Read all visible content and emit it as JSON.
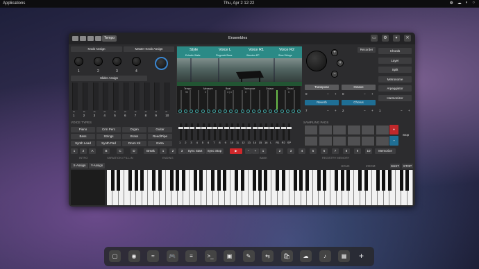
{
  "topbar": {
    "apps": "Applications",
    "clock": "Thu, Apr  2   12:22",
    "tray": [
      "❁",
      "☁",
      "◐",
      "○"
    ]
  },
  "window": {
    "title": "Ensembles",
    "tempo": "Tempo",
    "recorder": "Recorder"
  },
  "left": {
    "knob_assign": "Knob Assign",
    "master_knob_assign": "Master Knob Assign",
    "slider_assign": "Slider Assign",
    "knob_numbers": [
      "1",
      "2",
      "3",
      "4",
      "M"
    ],
    "slider_numbers": [
      "1",
      "2",
      "3",
      "4",
      "5",
      "6",
      "7",
      "8",
      "9",
      "10"
    ]
  },
  "screen": {
    "headers": [
      "Style",
      "Voice L",
      "Voice R1",
      "Voice R2"
    ],
    "subs": [
      "Eclectic Waltz",
      "Fingerstd Bass",
      "Wooden EP",
      "Slow Strings"
    ],
    "params": [
      "Tempo",
      "Measure",
      "Beat",
      "Transpose",
      "Octave",
      "Chord"
    ],
    "values": [
      "90",
      "0",
      "4 | 4",
      "0",
      "0",
      "C"
    ]
  },
  "right": {
    "buttons": [
      "Chords",
      "Layer",
      "Split",
      "Metronome",
      "Arpeggiator",
      "Harmonizer"
    ],
    "fx": [
      "Transpose",
      "Octave",
      "Reverb",
      "Chorus"
    ],
    "fx_vals": [
      "0",
      "0",
      "7",
      "2"
    ],
    "minus": "−",
    "plus": "+",
    "arp_val": "1"
  },
  "voice_types": {
    "title": "VOICE TYPES",
    "items": [
      "Piano",
      "Crm Perc",
      "Organ",
      "Guitar",
      "Bass",
      "Strings",
      "Brass",
      "Reed/Pipe",
      "Synth Lead",
      "Synth Pad",
      "Drum Kit",
      "Extra"
    ]
  },
  "mixer": {
    "labels": [
      "1",
      "2",
      "3",
      "4",
      "5",
      "6",
      "7",
      "8",
      "9",
      "10",
      "11",
      "12",
      "13",
      "14",
      "15",
      "16",
      "L",
      "R1",
      "R2",
      "SP"
    ]
  },
  "sampling": {
    "title": "SAMPLING PADS",
    "stop": "Stop"
  },
  "bottom_row": {
    "items": [
      "1",
      "2",
      "A",
      "B",
      "C",
      "D",
      "Break",
      "1",
      "2",
      "3",
      "Sync Start",
      "Sync Stop",
      "1",
      "−",
      "+",
      "1",
      "2",
      "3",
      "4",
      "5",
      "6",
      "7",
      "8",
      "9",
      "10",
      "Memorize"
    ],
    "section_labels": [
      "INTRO",
      "VARIATION / FILL-IN",
      "ENDING",
      "BANK",
      "REGISTRY MEMORY"
    ]
  },
  "keyboard": {
    "x_assign": "X-Assign",
    "y_assign": "Y-Assign",
    "hold": "HOLD",
    "zoom": "ZOOM",
    "sust": "SUST",
    "stop": "STOP"
  },
  "dock": {
    "icons": [
      "files",
      "chrome",
      "wave",
      "gamepad",
      "stack",
      "terminal",
      "case",
      "magic",
      "toggle",
      "store",
      "cloud",
      "ensembles",
      "grid"
    ],
    "add": "+"
  }
}
